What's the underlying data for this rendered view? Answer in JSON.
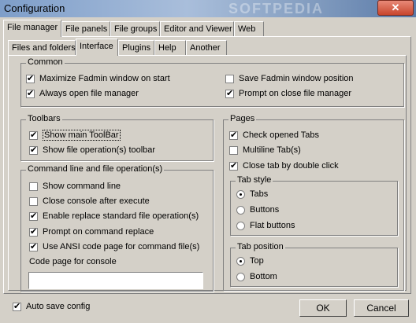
{
  "window": {
    "title": "Configuration",
    "watermark": "SOFTPEDIA",
    "close_glyph": "✕"
  },
  "main_tabs": [
    {
      "label": "File manager"
    },
    {
      "label": "File panels"
    },
    {
      "label": "File groups"
    },
    {
      "label": "Editor and Viewer"
    },
    {
      "label": "Web"
    }
  ],
  "sub_tabs": [
    {
      "label": "Files and folders"
    },
    {
      "label": "Interface"
    },
    {
      "label": "Plugins"
    },
    {
      "label": "Help"
    },
    {
      "label": "Another"
    }
  ],
  "common": {
    "legend": "Common",
    "items": [
      {
        "label": "Maximize Fadmin window on start",
        "checked": true
      },
      {
        "label": "Always open file manager",
        "checked": true
      },
      {
        "label": "Save Fadmin window position",
        "checked": false
      },
      {
        "label": "Prompt on close file manager",
        "checked": true
      }
    ]
  },
  "toolbars": {
    "legend": "Toolbars",
    "items": [
      {
        "label": "Show main ToolBar",
        "checked": true
      },
      {
        "label": "Show file operation(s) toolbar",
        "checked": true
      }
    ]
  },
  "cmdline": {
    "legend": "Command line and file operation(s)",
    "items": [
      {
        "label": "Show command line",
        "checked": false
      },
      {
        "label": "Close console after execute",
        "checked": false
      },
      {
        "label": "Enable replace standard file operation(s)",
        "checked": true
      },
      {
        "label": "Prompt on command replace",
        "checked": true
      },
      {
        "label": "Use ANSI code page for command file(s)",
        "checked": true
      }
    ],
    "codepage_label": "Code page for console",
    "codepage_value": ""
  },
  "pages": {
    "legend": "Pages",
    "items": [
      {
        "label": "Check opened Tabs",
        "checked": true
      },
      {
        "label": "Multiline Tab(s)",
        "checked": false
      },
      {
        "label": "Close tab by double click",
        "checked": true
      }
    ]
  },
  "tab_style": {
    "legend": "Tab style",
    "options": [
      {
        "label": "Tabs",
        "selected": true
      },
      {
        "label": "Buttons",
        "selected": false
      },
      {
        "label": "Flat buttons",
        "selected": false
      }
    ]
  },
  "tab_position": {
    "legend": "Tab position",
    "options": [
      {
        "label": "Top",
        "selected": true
      },
      {
        "label": "Bottom",
        "selected": false
      }
    ]
  },
  "footer": {
    "auto_save": {
      "label": "Auto save config",
      "checked": true
    },
    "ok_label": "OK",
    "cancel_label": "Cancel"
  }
}
